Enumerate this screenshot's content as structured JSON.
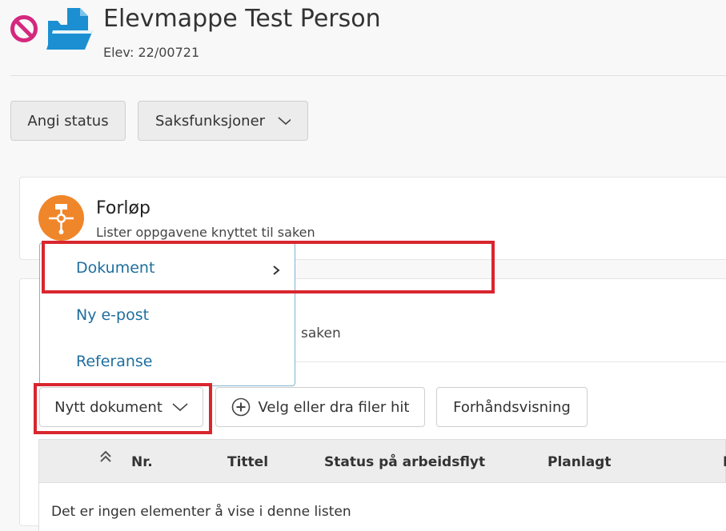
{
  "header": {
    "title": "Elevmappe Test Person",
    "subtitle": "Elev: 22/00721"
  },
  "toolbar": {
    "status_label": "Angi status",
    "functions_label": "Saksfunksjoner"
  },
  "forlop": {
    "title": "Forløp",
    "subtitle": "Lister oppgavene knyttet til saken"
  },
  "documents": {
    "subtitle_fragment": "saken",
    "new_document_label": "Nytt dokument",
    "upload_label": "Velg eller dra filer hit",
    "preview_label": "Forhåndsvisning"
  },
  "menu": {
    "items": [
      {
        "label": "Dokument"
      },
      {
        "label": "Ny e-post"
      },
      {
        "label": "Referanse"
      }
    ]
  },
  "table": {
    "columns": [
      "Nr.",
      "Tittel",
      "Status på arbeidsflyt",
      "Planlagt",
      "I"
    ],
    "empty_text": "Det er ingen elementer å vise i denne listen"
  },
  "colors": {
    "accent": "#1f6f9e",
    "highlight": "#d9262e",
    "forlop_icon": "#f0862a",
    "folder_icon": "#1b8fd1",
    "no_icon": "#d4287e"
  }
}
